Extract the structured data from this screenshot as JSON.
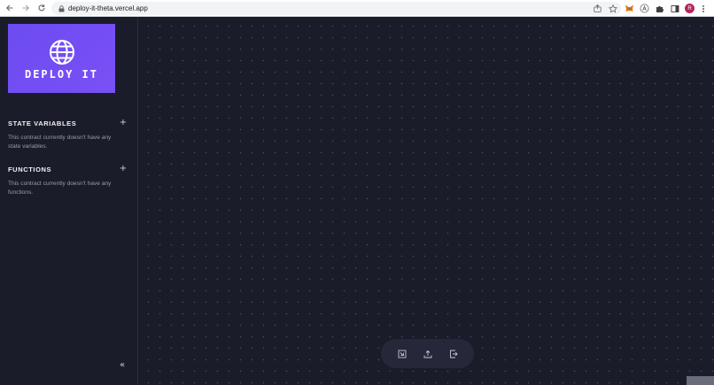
{
  "browser": {
    "url": "deploy-it-theta.vercel.app",
    "profile_initial": "R"
  },
  "logo": {
    "text": "DEPLOY IT"
  },
  "state_variables": {
    "title": "STATE VARIABLES",
    "empty_message": "This contract currently doesn't have any state variables."
  },
  "functions": {
    "title": "FUNCTIONS",
    "empty_message": "This contract currently doesn't have any functions."
  },
  "colors": {
    "background": "#1b1c29",
    "logo_accent": "#6c4cf2",
    "toolbar": "#262839"
  },
  "icons": {
    "add": "plus-icon",
    "collapse": "double-chevron-left-icon",
    "toolbar": [
      "code-icon",
      "upload-icon",
      "exit-icon"
    ]
  }
}
